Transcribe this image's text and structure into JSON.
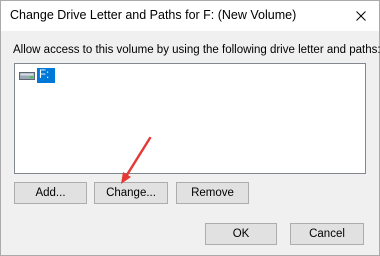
{
  "window": {
    "title": "Change Drive Letter and Paths for F: (New Volume)",
    "close_icon": "close-icon"
  },
  "instruction": "Allow access to this volume by using the following drive letter and paths:",
  "list": {
    "items": [
      {
        "label": "F:",
        "icon": "drive-icon",
        "selected": true
      }
    ]
  },
  "buttons": {
    "add": "Add...",
    "change": "Change...",
    "remove": "Remove",
    "ok": "OK",
    "cancel": "Cancel"
  },
  "colors": {
    "selection": "#0078d7",
    "annotation_arrow": "#e53935",
    "dialog_bg": "#f0f0f0"
  }
}
